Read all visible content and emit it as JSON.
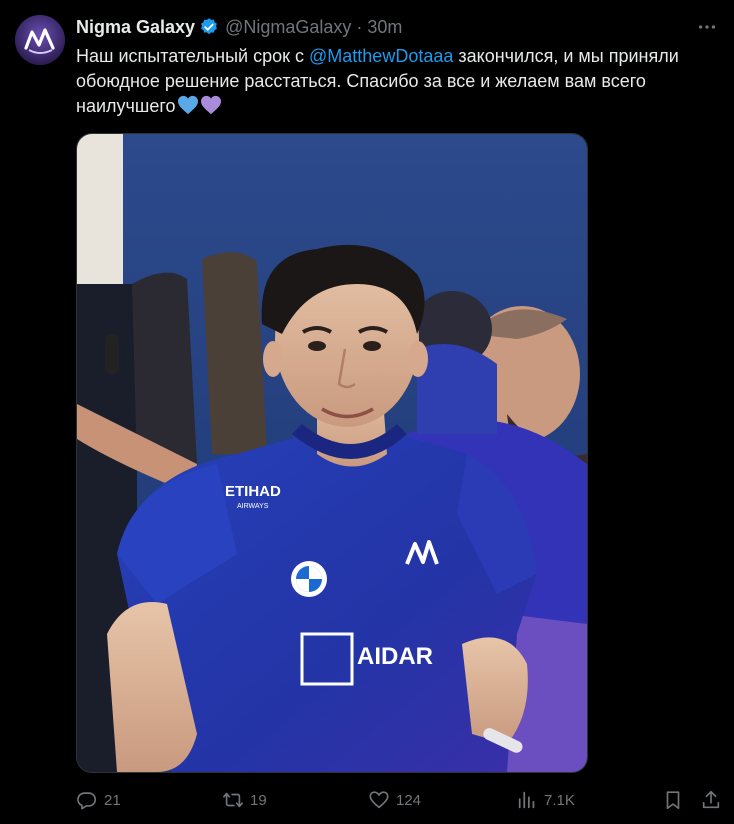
{
  "author": {
    "name": "Nigma Galaxy",
    "handle": "@NigmaGalaxy",
    "separator": "·",
    "time": "30m",
    "verified": true,
    "avatar_icon": "nigma-galaxy-logo"
  },
  "tweet": {
    "text_before": "Наш испытательный срок с ",
    "mention": "@MatthewDotaaa",
    "text_after": " закончился, и мы приняли обоюдное решение расстаться. Спасибо за все и желаем вам всего наилучшего",
    "emojis": [
      "blue-heart",
      "purple-heart"
    ]
  },
  "media": {
    "jersey_sponsor": "ETIHAD",
    "jersey_sponsor_sub": "AIRWAYS",
    "jersey_brand": "AIDAR"
  },
  "actions": {
    "replies": "21",
    "reposts": "19",
    "likes": "124",
    "views": "7.1K"
  },
  "colors": {
    "background": "#000000",
    "text": "#e7e9ea",
    "secondary": "#71767b",
    "link": "#1d9bf0",
    "blue_heart": "#5aa9e6",
    "purple_heart": "#a98bdb"
  }
}
